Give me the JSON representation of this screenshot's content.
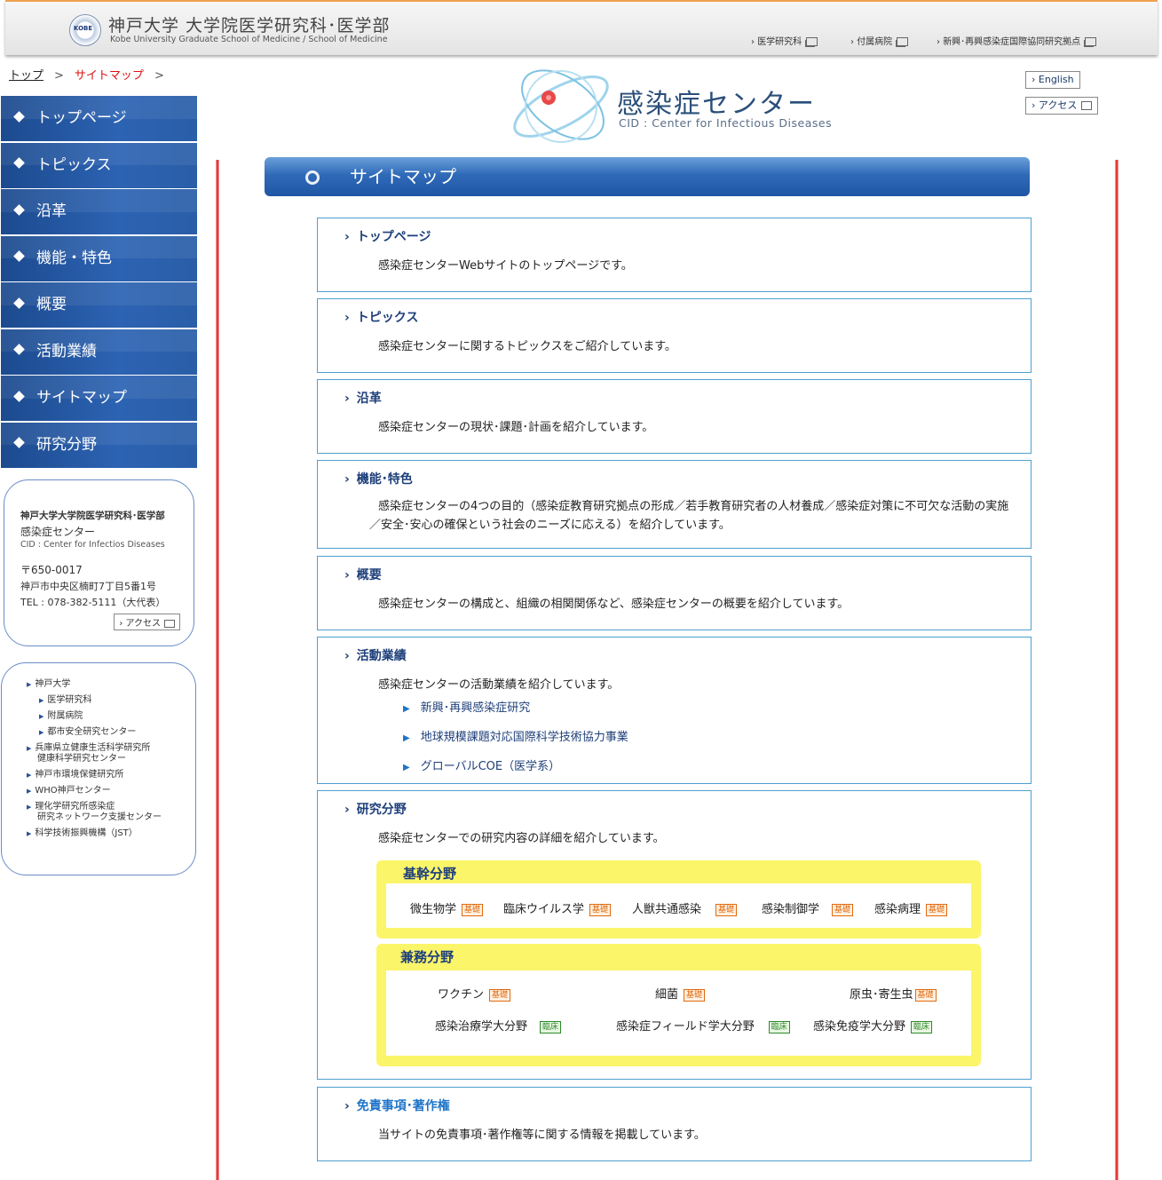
{
  "header": {
    "logo_text": "KOBE",
    "title": "神戸大学 大学院医学研究科･医学部",
    "subtitle": "Kobe University Graduate School of Medicine / School of Medicine",
    "links": [
      "医学研究科",
      "付属病院",
      "新興･再興感染症国際協同研究拠点"
    ]
  },
  "breadcrumb": {
    "top": "トップ",
    "sep": ">",
    "current": "サイトマップ"
  },
  "center_logo": {
    "title": "感染症センター",
    "subtitle": "CID : Center for Infectious Diseases"
  },
  "top_buttons": {
    "english": "English",
    "access": "アクセス"
  },
  "nav": [
    "トップページ",
    "トピックス",
    "沿革",
    "機能・特色",
    "概要",
    "活動業績",
    "サイトマップ",
    "研究分野"
  ],
  "address": {
    "org": "神戸大学大学院医学研究科･医学部",
    "center": "感染症センター",
    "cid": "CID : Center for Infectios Diseases",
    "postal": "〒650-0017",
    "addr": "神戸市中央区楠町7丁目5番1号",
    "tel": "TEL : 078-382-5111（大代表）",
    "access": "アクセス"
  },
  "links": [
    {
      "text": "神戸大学",
      "sub": false
    },
    {
      "text": "医学研究科",
      "sub": true
    },
    {
      "text": "附属病院",
      "sub": true
    },
    {
      "text": "都市安全研究センター",
      "sub": true
    },
    {
      "text": "兵庫県立健康生活科学研究所",
      "sub": false
    },
    {
      "text": "健康科学研究センター",
      "sub": false,
      "cont": true
    },
    {
      "text": "神戸市環境保健研究所",
      "sub": false
    },
    {
      "text": "WHO神戸センター",
      "sub": false
    },
    {
      "text": "理化学研究所感染症",
      "sub": false
    },
    {
      "text": "研究ネットワーク支援センター",
      "sub": false,
      "cont": true
    },
    {
      "text": "科学技術振興機構（JST）",
      "sub": false
    }
  ],
  "sitemap_title": "サイトマップ",
  "sections": [
    {
      "title": "トップページ",
      "desc": "感染症センターWebサイトのトップページです。"
    },
    {
      "title": "トピックス",
      "desc": "感染症センターに関するトピックスをご紹介しています。"
    },
    {
      "title": "沿革",
      "desc": "感染症センターの現状･課題･計画を紹介しています。"
    },
    {
      "title": "機能･特色",
      "desc": "感染症センターの4つの目的（感染症教育研究拠点の形成／若手教育研究者の人材養成／感染症対策に不可欠な活動の実施／安全･安心の確保という社会のニーズに応える）を紹介しています。"
    },
    {
      "title": "概要",
      "desc": "感染症センターの構成と、組織の相関関係など、感染症センターの概要を紹介しています。"
    },
    {
      "title": "活動業績",
      "desc": "感染症センターの活動業績を紹介しています。",
      "sublinks": [
        "新興･再興感染症研究",
        "地球規模課題対応国際科学技術協力事業",
        "グローバルCOE（医学系）"
      ]
    },
    {
      "title": "研究分野",
      "desc": "感染症センターでの研究内容の詳細を紹介しています。"
    },
    {
      "title": "免責事項･著作権",
      "desc": "当サイトの免責事項･著作権等に関する情報を掲載しています。"
    }
  ],
  "research": {
    "core_title": "基幹分野",
    "core": [
      {
        "name": "微生物学",
        "tag": "基礎"
      },
      {
        "name": "臨床ウイルス学",
        "tag": "基礎"
      },
      {
        "name": "人獣共通感染",
        "tag": "基礎"
      },
      {
        "name": "感染制御学",
        "tag": "基礎"
      },
      {
        "name": "感染病理",
        "tag": "基礎"
      }
    ],
    "joint_title": "兼務分野",
    "joint": [
      {
        "name": "ワクチン",
        "tag": "基礎"
      },
      {
        "name": "細菌",
        "tag": "基礎"
      },
      {
        "name": "原虫･寄生虫",
        "tag": "基礎"
      },
      {
        "name": "感染治療学大分野",
        "tag": "臨床"
      },
      {
        "name": "感染症フィールド学大分野",
        "tag": "臨床"
      },
      {
        "name": "感染免疫学大分野",
        "tag": "臨床"
      }
    ]
  },
  "colors": {
    "nav_blue": "#2a5ea8",
    "accent_red": "#e01010",
    "border_blue": "#4ea0d0",
    "field_yellow": "#fbf56a"
  }
}
